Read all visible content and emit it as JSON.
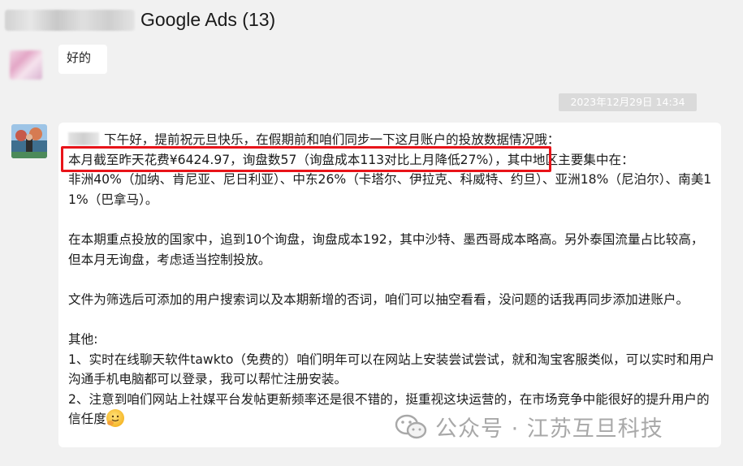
{
  "header": {
    "title": "Google Ads (13)"
  },
  "messages": {
    "first_reply": "好的",
    "timestamp": "2023年12月29日 14:34",
    "line1": "下午好，提前祝元旦快乐，在假期前和咱们同步一下这月账户的投放数据情况哦：",
    "line2_highlight": "本月截至昨天花费¥6424.97，询盘数57（询盘成本113对比上月降低27%），",
    "line2_tail": "其中地区主要集中在：",
    "line3": "非洲40%（加纳、肯尼亚、尼日利亚）、中东26%（卡塔尔、伊拉克、科威特、约旦）、亚洲18%（尼泊尔）、南美11%（巴拿马）。",
    "para2": "在本期重点投放的国家中，追到10个询盘，询盘成本192，其中沙特、墨西哥成本略高。另外泰国流量占比较高，但本月无询盘，考虑适当控制投放。",
    "para3": "文件为筛选后可添加的用户搜索词以及本期新增的否词，咱们可以抽空看看，没问题的话我再同步添加进账户。",
    "other_label": "其他:",
    "item1": "1、实时在线聊天软件tawkto（免费的）咱们明年可以在网站上安装尝试尝试，就和淘宝客服类似，可以实时和用户沟通手机电脑都可以登录，我可以帮忙注册安装。",
    "item2": "2、注意到咱们网站上社媒平台发帖更新频率还是很不错的，挺重视这块运营的，在市场竞争中能很好的提升用户的信任度"
  },
  "watermark": {
    "text": "公众号 · 江苏互旦科技"
  },
  "colors": {
    "highlight_border": "#e8141a",
    "background": "#f1f1f1",
    "bubble": "#ffffff",
    "timestamp_bg": "#dadada"
  },
  "icons": {
    "emoji": "smiling-face-with-hand-emoji",
    "watermark_icon": "wechat-icon"
  }
}
